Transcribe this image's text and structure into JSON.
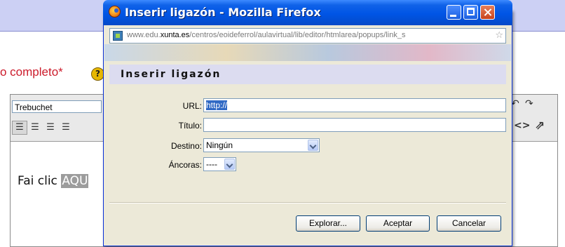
{
  "background": {
    "field_label": "o completo",
    "required_mark": "*",
    "help_glyph": "?",
    "editor": {
      "font_name": "Trebuchet",
      "toolbar_icons": [
        "align-left-icon",
        "align-center-icon",
        "align-right-icon",
        "align-justify-icon"
      ],
      "right_icons": [
        "undo-icon",
        "redo-icon",
        "html-source-icon",
        "fullscreen-icon"
      ],
      "content_text": "Fai clic ",
      "content_selected": "AQU"
    }
  },
  "window": {
    "title": "Inserir ligazón - Mozilla Firefox",
    "url_prefix": "www.edu.",
    "url_domain": "xunta.es",
    "url_rest": "/centros/eoideferrol/aulavirtual/lib/editor/htmlarea/popups/link_s",
    "accent": "#0055e5"
  },
  "dialog": {
    "heading": "Inserir ligazón",
    "fields": {
      "url_label": "URL:",
      "url_value": "http://",
      "title_label": "Título:",
      "title_value": "",
      "target_label": "Destino:",
      "target_value": "Ningún",
      "anchors_label": "Áncoras:",
      "anchors_value": "----"
    },
    "buttons": {
      "browse": "Explorar...",
      "ok": "Aceptar",
      "cancel": "Cancelar"
    }
  }
}
